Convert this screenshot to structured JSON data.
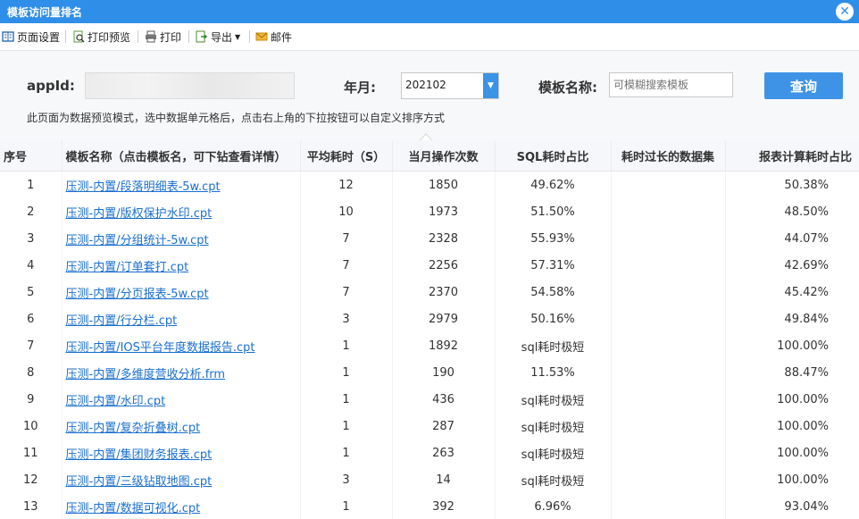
{
  "window": {
    "title": "模板访问量排名",
    "close_label": "✕"
  },
  "toolbar": {
    "page_setup": "页面设置",
    "print_preview": "打印预览",
    "print": "打印",
    "export": "导出",
    "mail": "邮件"
  },
  "filter": {
    "appid_label": "appId:",
    "yearmonth_label": "年月:",
    "yearmonth_value": "202102",
    "template_label": "模板名称:",
    "template_placeholder": "可模糊搜索模板",
    "query_button": "查询",
    "hint": "此页面为数据预览模式，选中数据单元格后，点击右上角的下拉按钮可以自定义排序方式"
  },
  "table": {
    "headers": [
      "序号",
      "模板名称（点击模板名，可下钻查看详情）",
      "平均耗时（S）",
      "当月操作次数",
      "SQL耗时占比",
      "耗时过长的数据集",
      "报表计算耗时占比"
    ],
    "rows": [
      [
        "1",
        "压测-内置/段落明细表-5w.cpt",
        "12",
        "1850",
        "49.62%",
        "",
        "50.38%"
      ],
      [
        "2",
        "压测-内置/版权保护水印.cpt",
        "10",
        "1973",
        "51.50%",
        "",
        "48.50%"
      ],
      [
        "3",
        "压测-内置/分组统计-5w.cpt",
        "7",
        "2328",
        "55.93%",
        "",
        "44.07%"
      ],
      [
        "4",
        "压测-内置/订单套打.cpt",
        "7",
        "2256",
        "57.31%",
        "",
        "42.69%"
      ],
      [
        "5",
        "压测-内置/分页报表-5w.cpt",
        "7",
        "2370",
        "54.58%",
        "",
        "45.42%"
      ],
      [
        "6",
        "压测-内置/行分栏.cpt",
        "3",
        "2979",
        "50.16%",
        "",
        "49.84%"
      ],
      [
        "7",
        "压测-内置/IOS平台年度数据报告.cpt",
        "1",
        "1892",
        "sql耗时极短",
        "",
        "100.00%"
      ],
      [
        "8",
        "压测-内置/多维度营收分析.frm",
        "1",
        "190",
        "11.53%",
        "",
        "88.47%"
      ],
      [
        "9",
        "压测-内置/水印.cpt",
        "1",
        "436",
        "sql耗时极短",
        "",
        "100.00%"
      ],
      [
        "10",
        "压测-内置/复杂折叠树.cpt",
        "1",
        "287",
        "sql耗时极短",
        "",
        "100.00%"
      ],
      [
        "11",
        "压测-内置/集团财务报表.cpt",
        "1",
        "263",
        "sql耗时极短",
        "",
        "100.00%"
      ],
      [
        "12",
        "压测-内置/三级钻取地图.cpt",
        "3",
        "14",
        "sql耗时极短",
        "",
        "100.00%"
      ],
      [
        "13",
        "压测-内置/数据可视化.cpt",
        "1",
        "392",
        "6.96%",
        "",
        "93.04%"
      ]
    ]
  },
  "colors": {
    "titlebar": "#2f8ee8",
    "accent": "#3f93e6",
    "link": "#1a6fce"
  }
}
